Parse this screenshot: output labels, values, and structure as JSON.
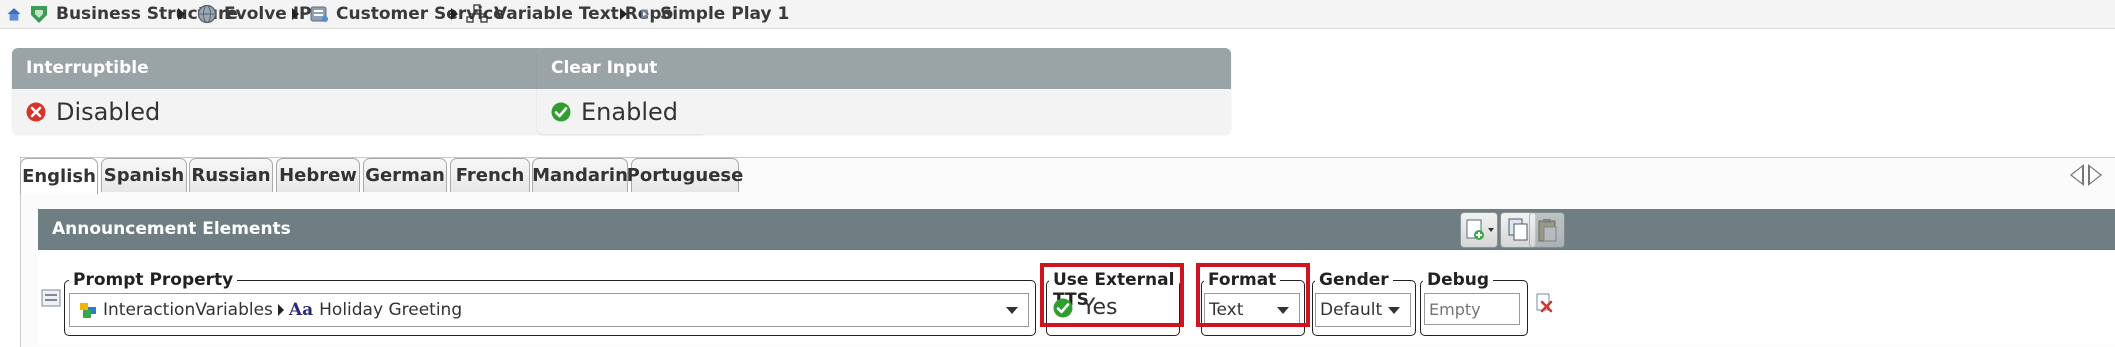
{
  "breadcrumb": {
    "items": [
      {
        "label": "Business Structure",
        "icon": "home-icon"
      },
      {
        "label": "Evolve IP",
        "icon": "globe-icon"
      },
      {
        "label": "Customer Service",
        "icon": "service-icon"
      },
      {
        "label": "Variable Text Repo",
        "icon": "hierarchy-icon"
      },
      {
        "label": "Simple Play 1",
        "icon": "play-icon"
      }
    ]
  },
  "status_cards": [
    {
      "title": "Interruptible",
      "value": "Disabled",
      "state": "error"
    },
    {
      "title": "Clear Input",
      "value": "Enabled",
      "state": "ok"
    }
  ],
  "tabs": {
    "items": [
      "English",
      "Spanish",
      "Russian",
      "Hebrew",
      "German",
      "French",
      "Mandarin",
      "Portuguese"
    ],
    "active": "English"
  },
  "panel": {
    "title": "Announcement Elements"
  },
  "row": {
    "prompt_property": {
      "label": "Prompt Property",
      "variable_group": "InteractionVariables",
      "variable": "Holiday Greeting"
    },
    "use_external_tts": {
      "label": "Use External TTS",
      "value": "Yes"
    },
    "format": {
      "label": "Format",
      "value": "Text"
    },
    "gender": {
      "label": "Gender",
      "value": "Default"
    },
    "debug": {
      "label": "Debug",
      "placeholder": "Empty"
    }
  },
  "colors": {
    "accent_highlight": "#d0141f",
    "panel_header": "#6e7e82",
    "card_header": "#9aa3a6",
    "ok_green": "#2f9e2f",
    "error_red": "#d9342b"
  }
}
